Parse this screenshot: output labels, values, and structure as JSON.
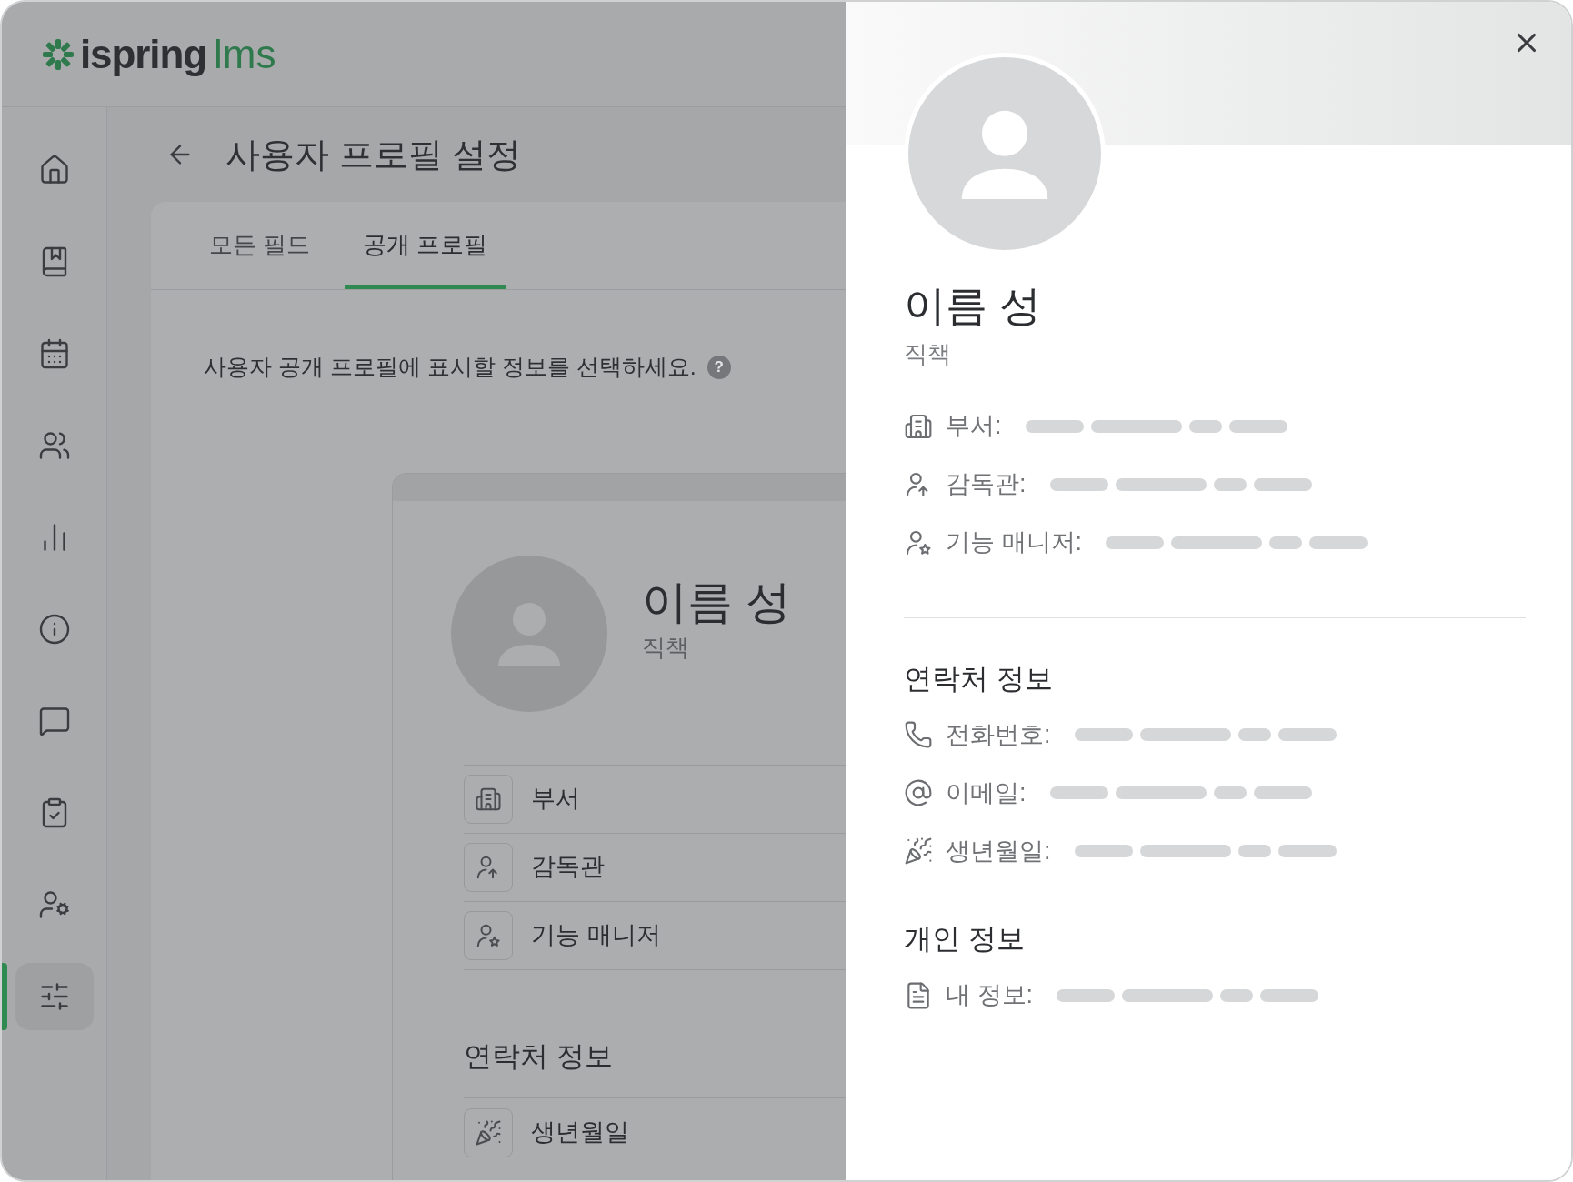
{
  "logo": {
    "brand": "ispring",
    "product": "lms"
  },
  "sidebar": {
    "items": [
      {
        "kind": "home",
        "selected": false
      },
      {
        "kind": "catalog",
        "selected": false
      },
      {
        "kind": "calendar",
        "selected": false
      },
      {
        "kind": "users",
        "selected": false
      },
      {
        "kind": "reports",
        "selected": false
      },
      {
        "kind": "info",
        "selected": false
      },
      {
        "kind": "questions",
        "selected": false
      },
      {
        "kind": "tasks",
        "selected": false
      },
      {
        "kind": "admin",
        "selected": false
      },
      {
        "kind": "settings",
        "selected": true
      }
    ]
  },
  "page": {
    "title": "사용자 프로필 설정",
    "tabs": [
      {
        "label": "모든 필드",
        "selected": false
      },
      {
        "label": "공개 프로필",
        "selected": true
      }
    ],
    "description": "사용자 공개 프로필에 표시할 정보를 선택하세요.",
    "help_mark": "?",
    "preview": {
      "name": "이름 성",
      "job_title": "직책",
      "fields": [
        {
          "kind": "department",
          "label": "부서"
        },
        {
          "kind": "supervisor",
          "label": "감독관"
        },
        {
          "kind": "manager",
          "label": "기능 매니저"
        }
      ],
      "contact_heading": "연락처 정보",
      "contact_fields": [
        {
          "kind": "birthday",
          "label": "생년월일"
        }
      ]
    }
  },
  "profile_panel": {
    "name": "이름 성",
    "job_title": "직책",
    "fields": [
      {
        "kind": "department",
        "label": "부서:"
      },
      {
        "kind": "supervisor",
        "label": "감독관:"
      },
      {
        "kind": "manager",
        "label": "기능 매니저:"
      }
    ],
    "sections": [
      {
        "heading": "연락처 정보",
        "fields": [
          {
            "kind": "phone",
            "label": "전화번호:"
          },
          {
            "kind": "email",
            "label": "이메일:"
          },
          {
            "kind": "birthday",
            "label": "생년월일:"
          }
        ]
      },
      {
        "heading": "개인 정보",
        "fields": [
          {
            "kind": "about",
            "label": "내 정보:"
          }
        ]
      }
    ]
  }
}
